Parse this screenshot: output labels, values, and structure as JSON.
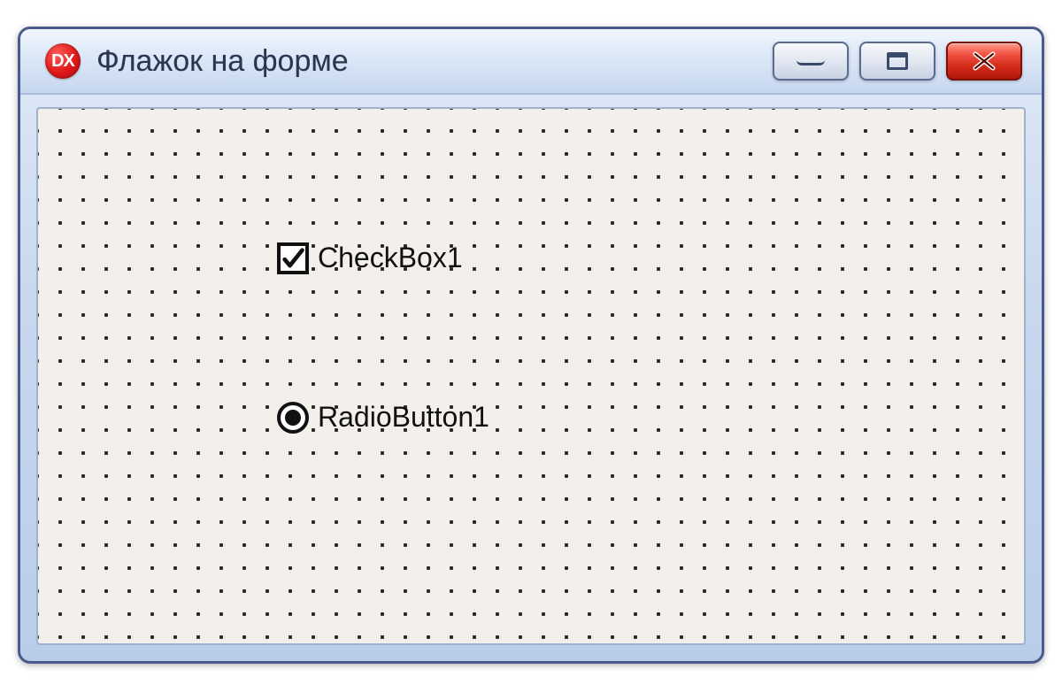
{
  "window": {
    "title": "Флажок на форме",
    "app_icon_text": "DX"
  },
  "controls": {
    "checkbox": {
      "label": "CheckBox1",
      "checked": true
    },
    "radio": {
      "label": "RadioButton1",
      "checked": true
    }
  }
}
